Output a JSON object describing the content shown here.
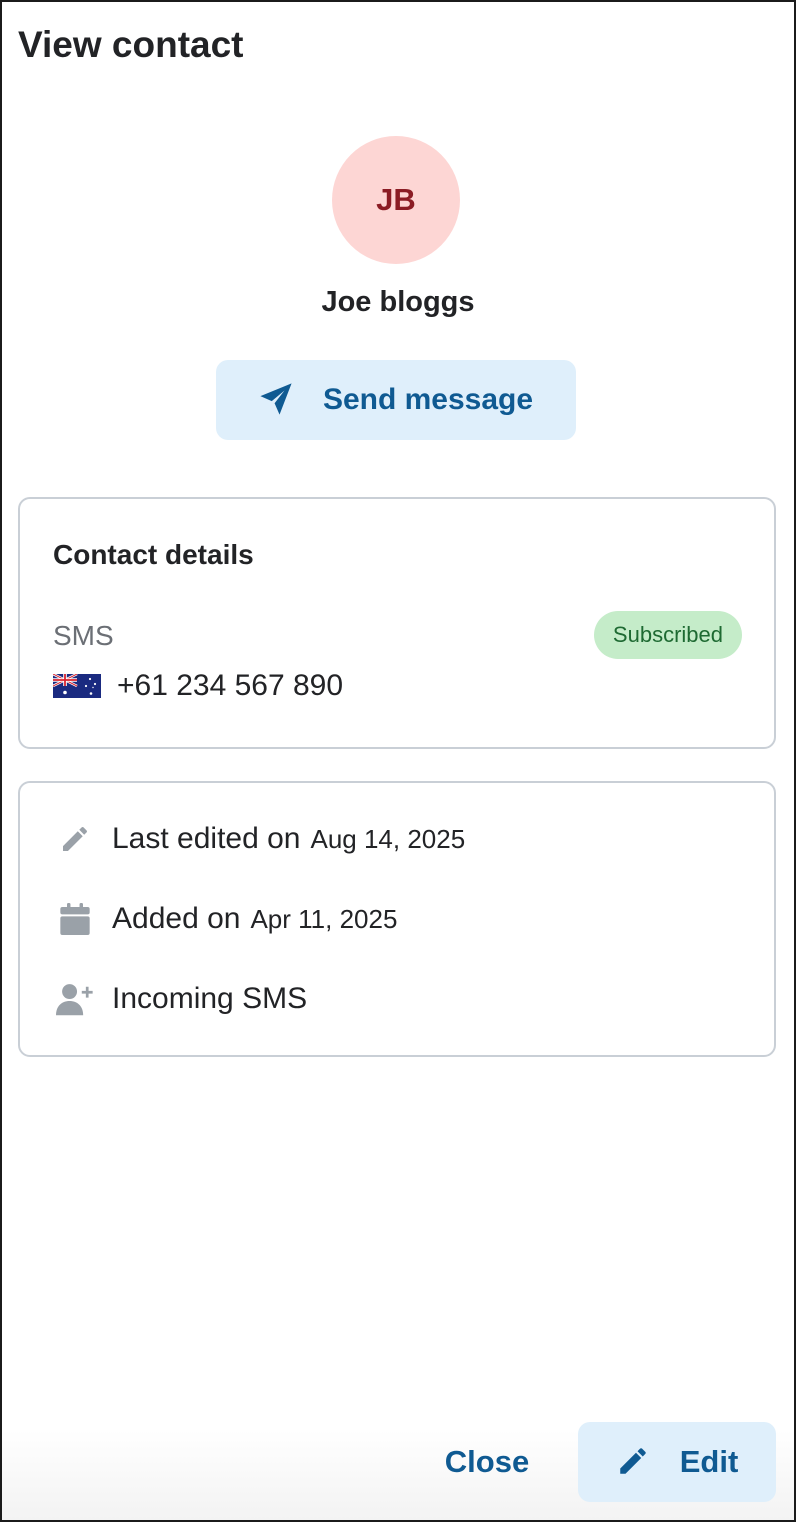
{
  "page": {
    "title": "View contact"
  },
  "contact": {
    "initials": "JB",
    "name": "Joe bloggs",
    "avatar_bg": "#fdd6d4",
    "avatar_fg": "#8b1c24"
  },
  "actions": {
    "send_message_label": "Send message",
    "send_icon": "paper-plane-icon"
  },
  "contact_details": {
    "title": "Contact details",
    "channel": "SMS",
    "status": "Subscribed",
    "status_color": "#c5ecc9",
    "flag_icon": "australia-flag-icon",
    "phone": "+61 234 567 890"
  },
  "meta": {
    "last_edited_label": "Last edited on",
    "last_edited_date": "Aug 14, 2025",
    "last_edited_icon": "pencil-icon",
    "added_label": "Added on",
    "added_date": "Apr 11, 2025",
    "added_icon": "calendar-icon",
    "source": "Incoming SMS",
    "source_icon": "user-plus-icon"
  },
  "footer": {
    "close_label": "Close",
    "edit_label": "Edit",
    "edit_icon": "pencil-icon",
    "accent_color": "#0f5a92"
  }
}
